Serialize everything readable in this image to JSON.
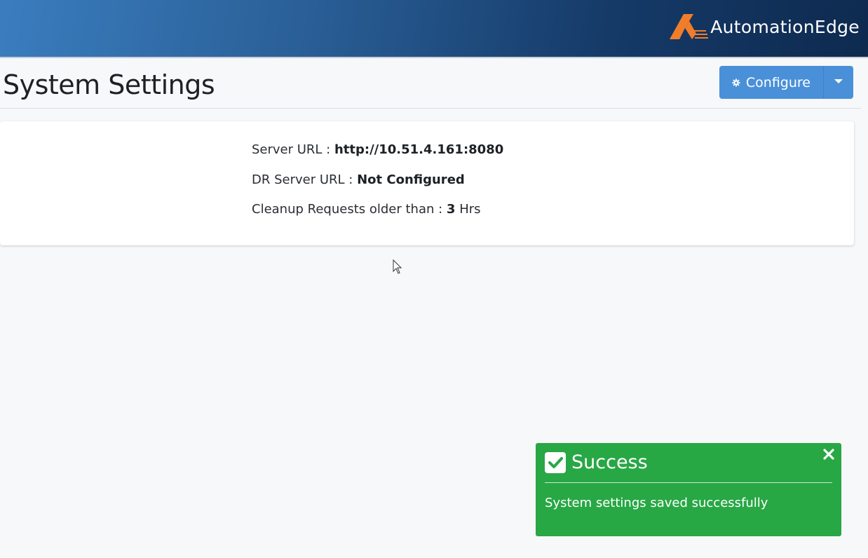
{
  "header": {
    "brand_name": "AutomationEdge",
    "brand_color": "#f07d2a",
    "logo_icon": "automationedge-logo-icon"
  },
  "page": {
    "title": "System Settings"
  },
  "toolbar": {
    "configure_label": "Configure",
    "configure_icon": "gear-icon",
    "dropdown_icon": "caret-down-icon",
    "accent_color": "#4a90d9"
  },
  "settings": {
    "server_url_label": "Server URL :",
    "server_url_value": "http://10.51.4.161:8080",
    "dr_server_url_label": "DR Server URL :",
    "dr_server_url_value": "Not Configured",
    "cleanup_label": "Cleanup Requests older than :",
    "cleanup_value": "3",
    "cleanup_unit": "Hrs"
  },
  "toast": {
    "title": "Success",
    "message": "System settings saved successfully",
    "status_color": "#28a745",
    "check_icon": "check-square-icon",
    "close_icon": "close-icon"
  }
}
